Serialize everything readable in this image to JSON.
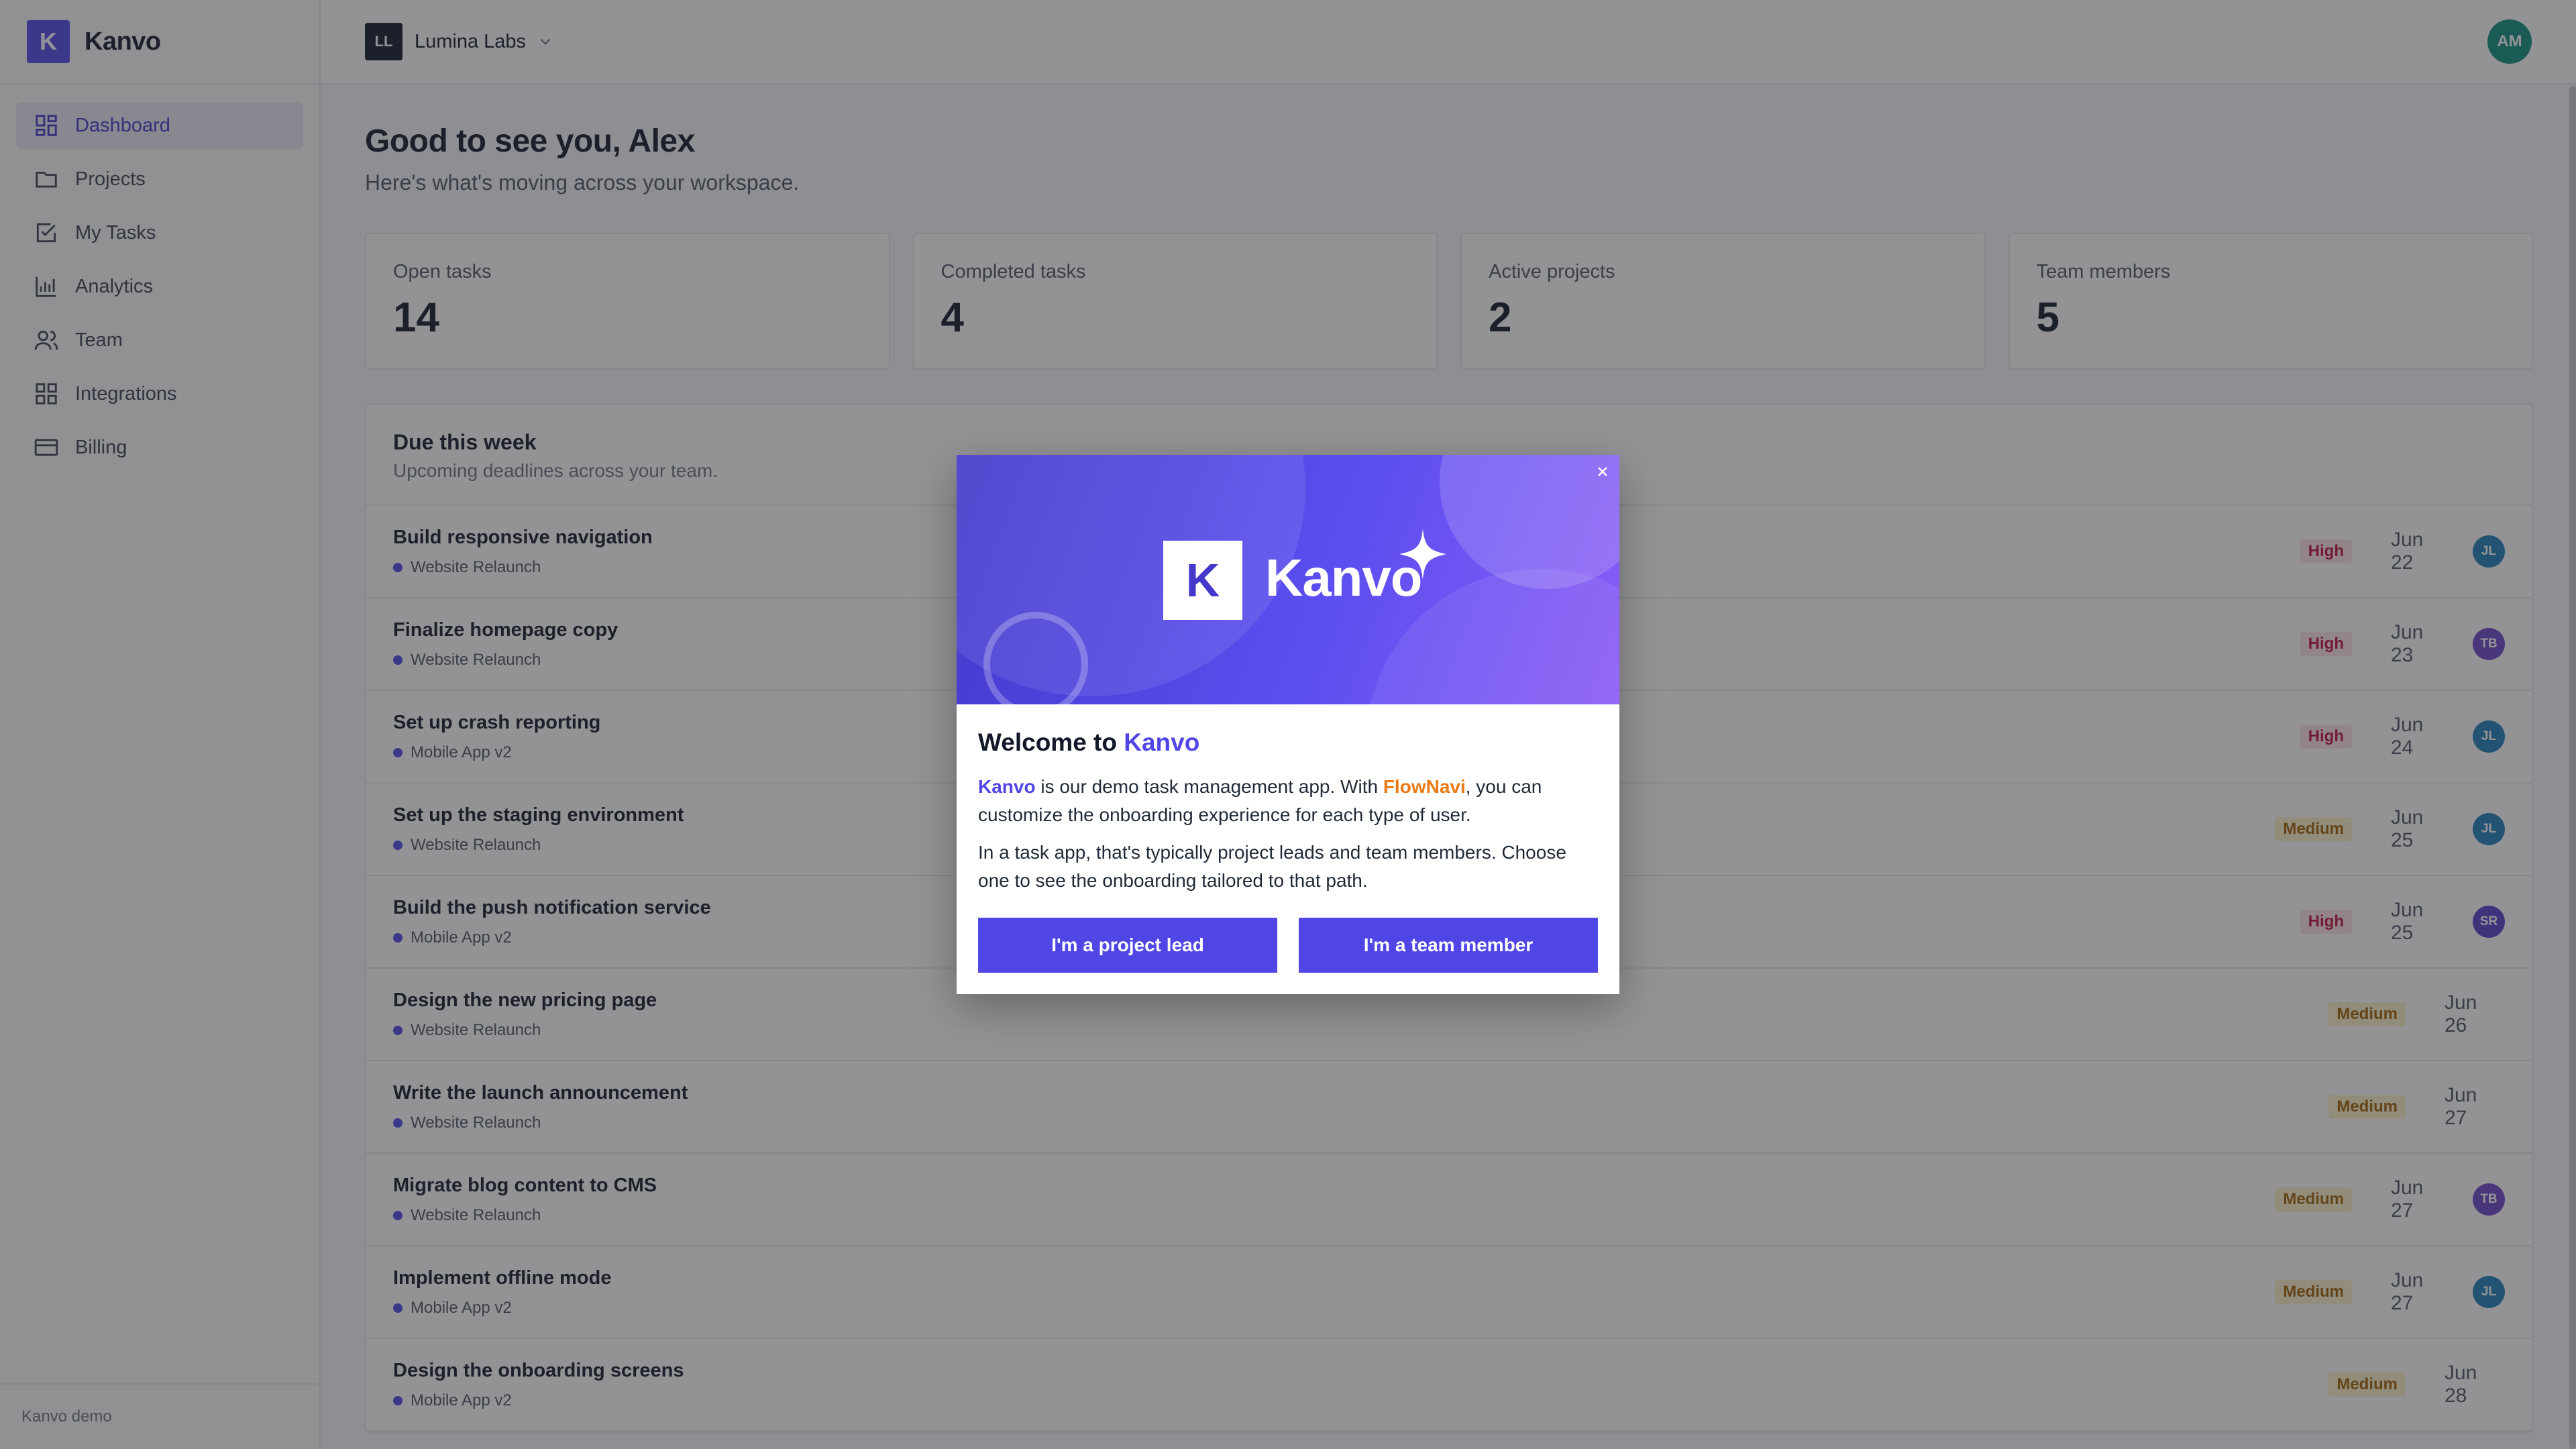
{
  "app": {
    "name": "Kanvo",
    "logo_letter": "K",
    "footer": "Kanvo demo"
  },
  "sidebar": {
    "items": [
      {
        "label": "Dashboard",
        "icon": "dashboard-icon",
        "active": true
      },
      {
        "label": "Projects",
        "icon": "folder-icon"
      },
      {
        "label": "My Tasks",
        "icon": "checkbox-icon"
      },
      {
        "label": "Analytics",
        "icon": "bar-chart-icon"
      },
      {
        "label": "Team",
        "icon": "users-icon"
      },
      {
        "label": "Integrations",
        "icon": "grid-icon"
      },
      {
        "label": "Billing",
        "icon": "credit-card-icon"
      }
    ]
  },
  "topbar": {
    "workspace_initials": "LL",
    "workspace_name": "Lumina Labs",
    "user_initials": "AM"
  },
  "main": {
    "greeting": "Good to see you, Alex",
    "subtitle": "Here's what's moving across your workspace.",
    "stats": [
      {
        "label": "Open tasks",
        "value": "14"
      },
      {
        "label": "Completed tasks",
        "value": "4"
      },
      {
        "label": "Active projects",
        "value": "2"
      },
      {
        "label": "Team members",
        "value": "5"
      }
    ],
    "due": {
      "title": "Due this week",
      "subtitle": "Upcoming deadlines across your team.",
      "tasks": [
        {
          "title": "Build responsive navigation",
          "project": "Website Relaunch",
          "priority": "High",
          "date": "Jun 22",
          "assignee": "JL"
        },
        {
          "title": "Finalize homepage copy",
          "project": "Website Relaunch",
          "priority": "High",
          "date": "Jun 23",
          "assignee": "TB"
        },
        {
          "title": "Set up crash reporting",
          "project": "Mobile App v2",
          "priority": "High",
          "date": "Jun 24",
          "assignee": "JL"
        },
        {
          "title": "Set up the staging environment",
          "project": "Website Relaunch",
          "priority": "Medium",
          "date": "Jun 25",
          "assignee": "JL"
        },
        {
          "title": "Build the push notification service",
          "project": "Mobile App v2",
          "priority": "High",
          "date": "Jun 25",
          "assignee": "SR"
        },
        {
          "title": "Design the new pricing page",
          "project": "Website Relaunch",
          "priority": "Medium",
          "date": "Jun 26",
          "assignee": ""
        },
        {
          "title": "Write the launch announcement",
          "project": "Website Relaunch",
          "priority": "Medium",
          "date": "Jun 27",
          "assignee": ""
        },
        {
          "title": "Migrate blog content to CMS",
          "project": "Website Relaunch",
          "priority": "Medium",
          "date": "Jun 27",
          "assignee": "TB"
        },
        {
          "title": "Implement offline mode",
          "project": "Mobile App v2",
          "priority": "Medium",
          "date": "Jun 27",
          "assignee": "JL"
        },
        {
          "title": "Design the onboarding screens",
          "project": "Mobile App v2",
          "priority": "Medium",
          "date": "Jun 28",
          "assignee": ""
        }
      ]
    }
  },
  "assignee_colors": {
    "JL": "#1f7fb8",
    "TB": "#6d44c9",
    "SR": "#5a3fc8"
  },
  "modal": {
    "hero_letter": "K",
    "hero_name": "Kanvo",
    "title_prefix": "Welcome to ",
    "title_accent": "Kanvo",
    "para1_brand": "Kanvo",
    "para1_mid": " is our demo task management app. With ",
    "para1_flow": "FlowNavi",
    "para1_end": ", you can customize the onboarding experience for each type of user.",
    "para2": "In a task app, that's typically project leads and team members. Choose one to see the onboarding tailored to that path.",
    "btn_lead": "I'm a project lead",
    "btn_member": "I'm a team member",
    "close_glyph": "×"
  },
  "colors": {
    "accent": "#4f46e5",
    "flow": "#ea7a13",
    "high": "#be123c",
    "medium": "#a16207"
  }
}
